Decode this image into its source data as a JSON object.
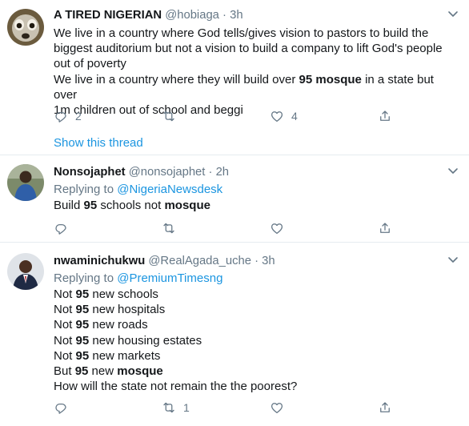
{
  "tweets": [
    {
      "name": "A TIRED NIGERIAN",
      "handle": "@hobiaga",
      "dot": "·",
      "time": "3h",
      "text_lines": [
        "We live in a country where God  tells/gives vision to pastors to build the",
        "biggest auditorium but not a vision to build a company to lift God's people",
        "out of poverty",
        "We live in a country where they will build over |95 mosque| in a state but over",
        "1m children out of school and beggi"
      ],
      "replies": "2",
      "retweets": "",
      "likes": "4",
      "show_thread": "Show this thread"
    },
    {
      "name": "Nonsojaphet",
      "handle": "@nonsojaphet",
      "dot": "·",
      "time": "2h",
      "replying_prefix": "Replying to ",
      "replying_to": "@NigeriaNewsdesk",
      "text_lines": [
        "Build |95| schools not |mosque|"
      ],
      "replies": "",
      "retweets": "",
      "likes": ""
    },
    {
      "name": "nwaminichukwu",
      "handle": "@RealAgada_uche",
      "dot": "·",
      "time": "3h",
      "replying_prefix": "Replying to ",
      "replying_to": "@PremiumTimesng",
      "text_lines": [
        "Not |95| new schools",
        "Not |95| new hospitals",
        "Not |95| new roads",
        "Not |95| new housing estates",
        "Not |95| new markets",
        "But |95| new |mosque|",
        "How will the state not remain the the poorest?"
      ],
      "replies": "",
      "retweets": "1",
      "likes": ""
    }
  ],
  "icons": {
    "reply": "reply-icon",
    "retweet": "retweet-icon",
    "like": "heart-icon",
    "share": "share-icon",
    "menu": "chevron-down-icon"
  },
  "colors": {
    "link": "#1b95e0",
    "muted": "#657786",
    "text": "#14171a",
    "divider": "#e6ecf0"
  }
}
